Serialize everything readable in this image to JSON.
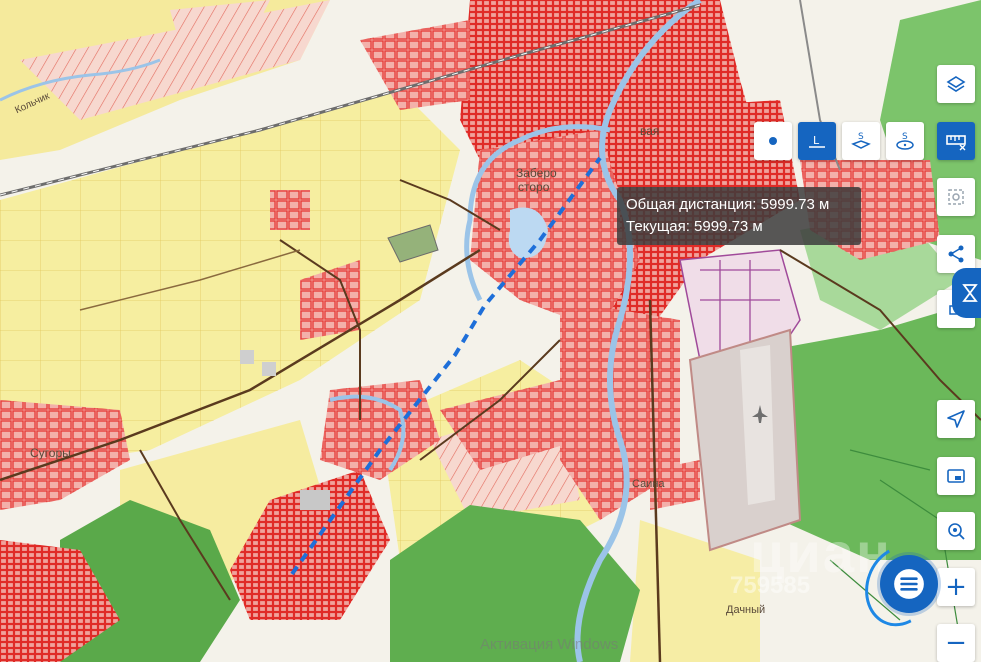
{
  "tooltip": {
    "total_distance": "Общая дистанция: 5999.73 м",
    "current": "Текущая: 5999.73 м"
  },
  "map_labels": {
    "kolchik": "Кольчик",
    "suguri": "Сугоры",
    "zaberezhnaya": "Заберо",
    "storona": "сторо",
    "dachny": "Дачный",
    "vaya": "вая",
    "sayna": "Саина"
  },
  "toolbar": {
    "measure_point": "point",
    "measure_line": "L",
    "measure_area": "S",
    "measure_circle": "S"
  },
  "watermarks": {
    "windows": "Активация Windows",
    "brand": "циан",
    "phone": "759585"
  },
  "icons": {
    "layers": "layers-icon",
    "ruler": "ruler-icon",
    "select": "select-area-icon",
    "share": "share-icon",
    "locate": "navigate-icon",
    "panorama": "panorama-icon",
    "geo-search": "geo-search-icon",
    "zoom_in": "+",
    "zoom_out": "−",
    "chat": "chat-icon"
  },
  "colors": {
    "accent": "#1565c0",
    "parcel": "#e53935",
    "forest": "#5fae4f",
    "yellow_zone": "#f7ef9e",
    "route": "#1e6fd9"
  }
}
